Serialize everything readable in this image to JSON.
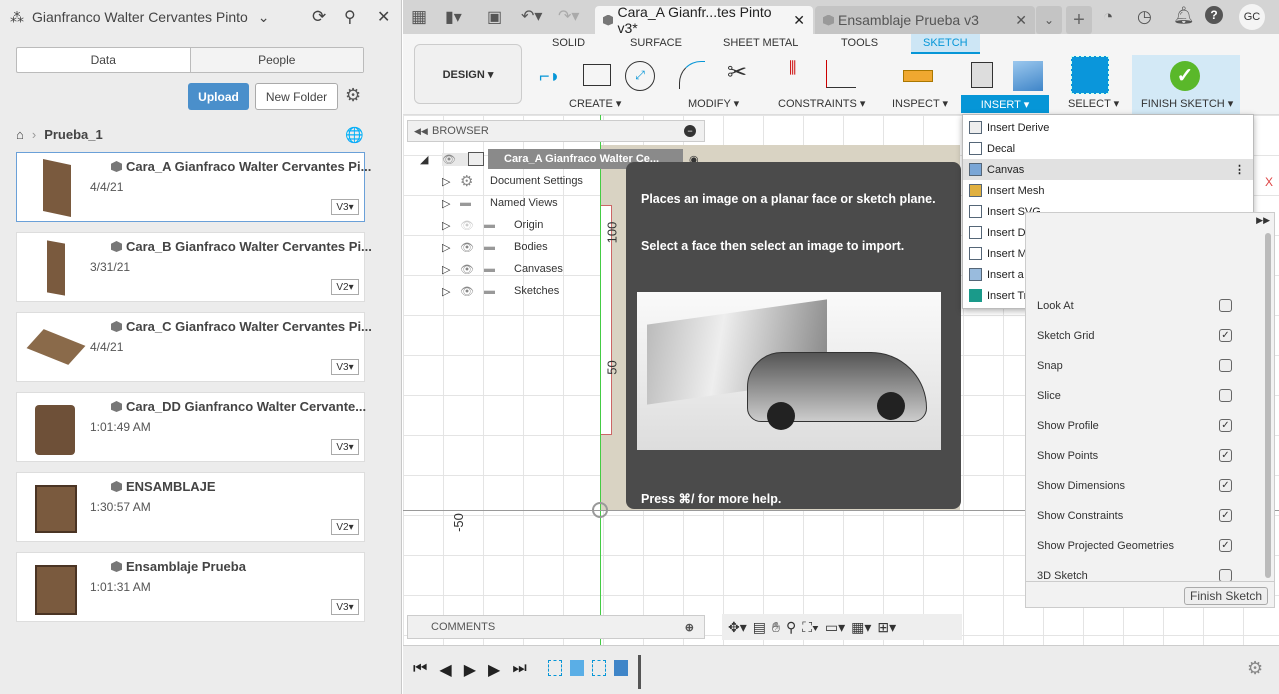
{
  "left_panel": {
    "project": "Gianfranco Walter Cervantes Pinto",
    "tabs": [
      "Data",
      "People"
    ],
    "upload_label": "Upload",
    "new_folder_label": "New Folder",
    "breadcrumb": "Prueba_1",
    "items": [
      {
        "name": "Cara_A Gianfraco Walter Cervantes Pi...",
        "date": "4/4/21",
        "version": "V3"
      },
      {
        "name": "Cara_B Gianfraco Walter Cervantes Pi...",
        "date": "3/31/21",
        "version": "V2"
      },
      {
        "name": "Cara_C Gianfraco Walter Cervantes Pi...",
        "date": "4/4/21",
        "version": "V3"
      },
      {
        "name": "Cara_DD Gianfranco Walter Cervante...",
        "date": "1:01:49 AM",
        "version": "V3"
      },
      {
        "name": "ENSAMBLAJE",
        "date": "1:30:57 AM",
        "version": "V2"
      },
      {
        "name": "Ensamblaje Prueba",
        "date": "1:01:31 AM",
        "version": "V3"
      }
    ]
  },
  "doc_tabs": [
    "Cara_A Gianfr...tes Pinto v3*",
    "Ensamblaje Prueba v3"
  ],
  "user_initials": "GC",
  "ribbon": {
    "workspace": "DESIGN ▾",
    "tabs": [
      "SOLID",
      "SURFACE",
      "SHEET METAL",
      "TOOLS",
      "SKETCH"
    ],
    "groups": [
      "CREATE ▾",
      "MODIFY ▾",
      "CONSTRAINTS ▾",
      "INSPECT ▾",
      "INSERT ▾",
      "SELECT ▾",
      "FINISH SKETCH ▾"
    ]
  },
  "browser": {
    "title": "BROWSER",
    "root": "Cara_A Gianfraco Walter Ce...",
    "nodes": [
      "Document Settings",
      "Named Views",
      "Origin",
      "Bodies",
      "Canvases",
      "Sketches"
    ]
  },
  "canvas": {
    "dim_labels": [
      "100",
      "50",
      "-50"
    ]
  },
  "tooltip": {
    "line1": "Places an image on a planar face or sketch plane.",
    "line2": "Select a face then select an image to import.",
    "footer": "Press ⌘/ for more help."
  },
  "insert_menu": [
    "Insert Derive",
    "Decal",
    "Canvas",
    "Insert Mesh",
    "Insert SVG",
    "Insert DXF",
    "Insert McMaster-Carr Component",
    "Insert a manufacturer part",
    "Insert TraceParts Supplier Components"
  ],
  "sketch_palette": {
    "options": [
      {
        "label": "Look At",
        "checked": false
      },
      {
        "label": "Sketch Grid",
        "checked": true
      },
      {
        "label": "Snap",
        "checked": false
      },
      {
        "label": "Slice",
        "checked": false
      },
      {
        "label": "Show Profile",
        "checked": true
      },
      {
        "label": "Show Points",
        "checked": true
      },
      {
        "label": "Show Dimensions",
        "checked": true
      },
      {
        "label": "Show Constraints",
        "checked": true
      },
      {
        "label": "Show Projected Geometries",
        "checked": true
      },
      {
        "label": "3D Sketch",
        "checked": false
      }
    ],
    "finish_label": "Finish Sketch"
  },
  "comments_label": "COMMENTS",
  "colors": {
    "accent": "#0696d7",
    "upload": "#4a8fcb",
    "finish_green": "#5ab82a",
    "tooltip_bg": "#4b4b4b"
  }
}
